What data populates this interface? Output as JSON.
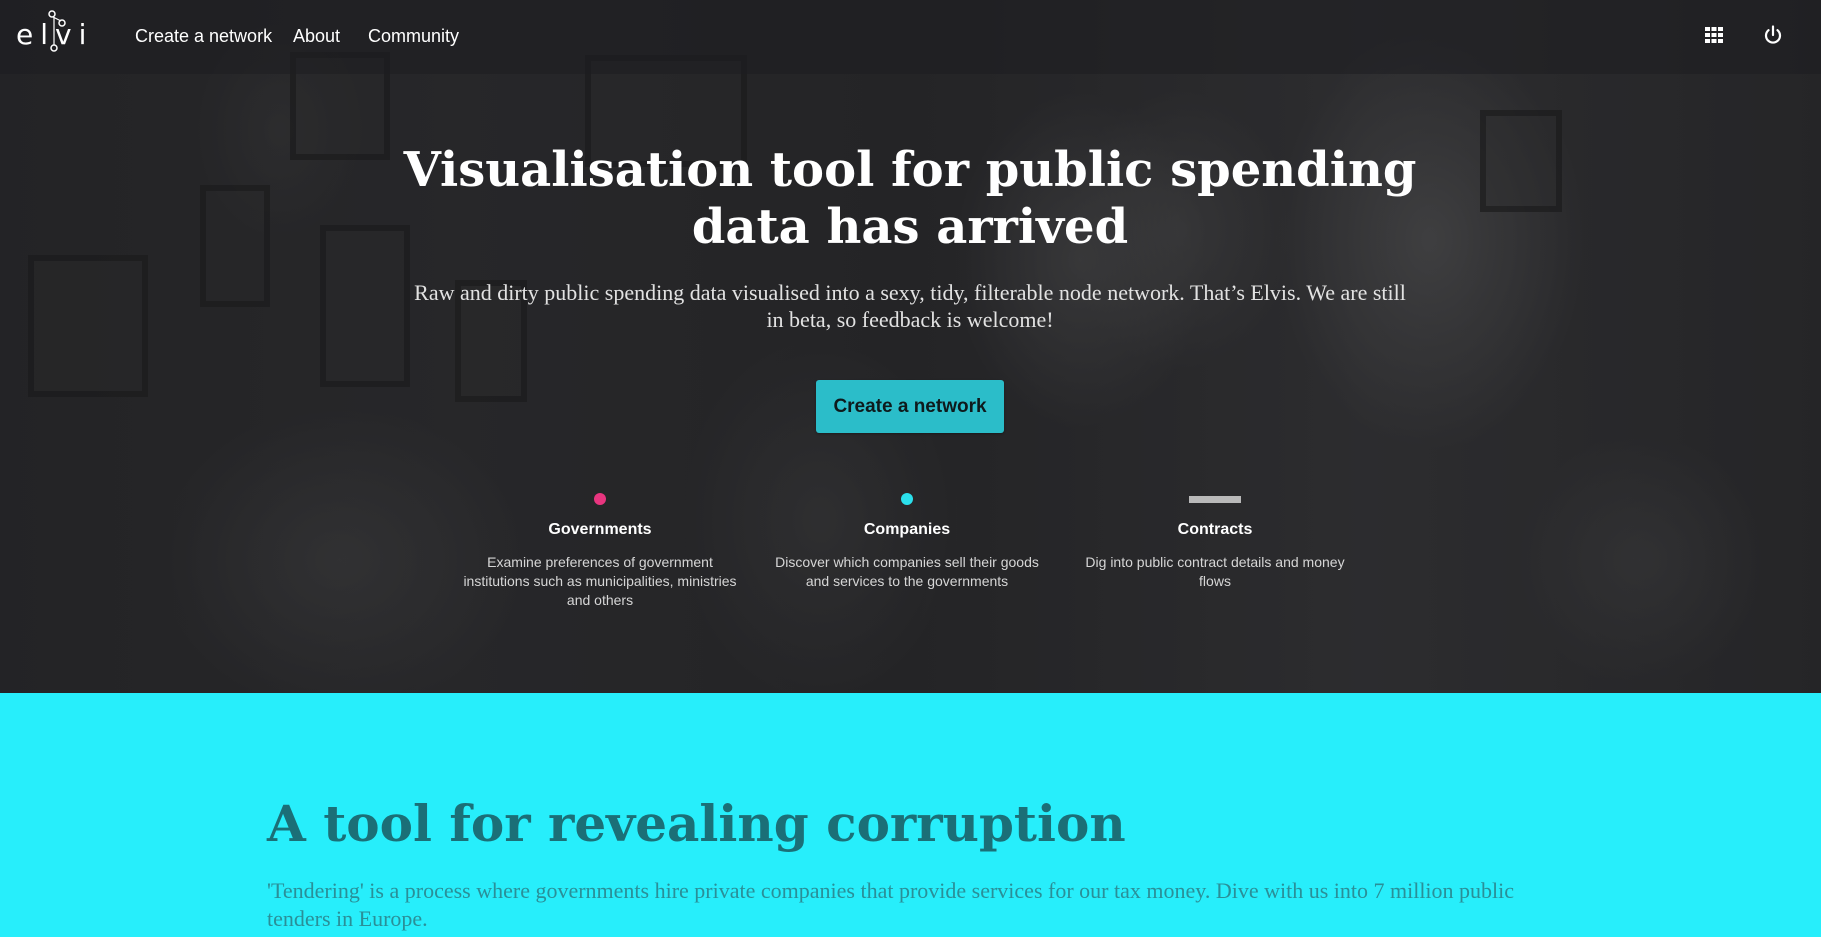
{
  "nav": {
    "logo_text": "elvis",
    "links": [
      "Create a network",
      "About",
      "Community"
    ],
    "apps_icon": "grid-icon",
    "power_icon": "power-icon"
  },
  "hero": {
    "title": "Visualisation tool for public spending data has arrived",
    "subtitle": "Raw and dirty public spending data visualised into a sexy, tidy, filterable node network. That’s Elvis. We are still in beta, so feedback is welcome!",
    "cta_label": "Create a network",
    "features": [
      {
        "title": "Governments",
        "description": "Examine preferences of government institutions such as municipalities, ministries and others",
        "icon": "dot-icon",
        "color": "#e8357f"
      },
      {
        "title": "Companies",
        "description": "Discover which companies sell their goods and services to the governments",
        "icon": "dot-icon",
        "color": "#2be0ec"
      },
      {
        "title": "Contracts",
        "description": "Dig into public contract details and money flows",
        "icon": "bar-icon",
        "color": "#b9b9b9"
      }
    ]
  },
  "section_tool": {
    "title": "A tool for revealing corruption",
    "text": "'Tendering' is a process where governments hire private companies that provide services for our tax money. Dive with us into 7 million public tenders in Europe."
  },
  "colors": {
    "accent_button": "#2bbdc9",
    "section_background": "#27eefb",
    "section_title": "#1b6f77"
  }
}
